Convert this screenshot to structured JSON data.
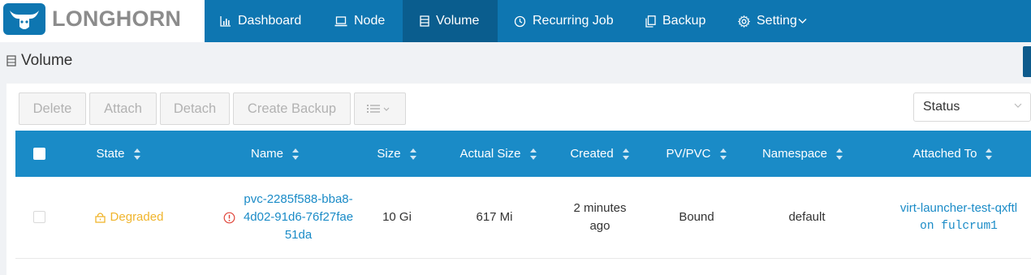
{
  "app": {
    "name": "LONGHORN"
  },
  "nav": [
    {
      "label": "Dashboard",
      "icon": "bar-chart-icon"
    },
    {
      "label": "Node",
      "icon": "laptop-icon"
    },
    {
      "label": "Volume",
      "icon": "database-icon",
      "active": true
    },
    {
      "label": "Recurring Job",
      "icon": "clock-icon"
    },
    {
      "label": "Backup",
      "icon": "copy-icon"
    },
    {
      "label": "Setting",
      "icon": "gear-icon"
    }
  ],
  "page": {
    "title": "Volume"
  },
  "toolbar": {
    "delete": "Delete",
    "attach": "Attach",
    "detach": "Detach",
    "create_backup": "Create Backup"
  },
  "filter": {
    "placeholder": "Status"
  },
  "columns": [
    "State",
    "Name",
    "Size",
    "Actual Size",
    "Created",
    "PV/PVC",
    "Namespace",
    "Attached To"
  ],
  "rows": [
    {
      "state": "Degraded",
      "name_lines": [
        "pvc-2285f588-bba8-",
        "4d02-91d6-76f27fae",
        "51da"
      ],
      "size": "10 Gi",
      "actual_size": "617 Mi",
      "created_lines": [
        "2 minutes",
        "ago"
      ],
      "pv_pvc": "Bound",
      "namespace": "default",
      "attached_to": "virt-launcher-test-qxftl",
      "attached_node": "on fulcrum1"
    }
  ],
  "colors": {
    "brand": "#0e76b1",
    "active_nav": "#0a5d8e",
    "table_header": "#1a8bc7",
    "degraded": "#f0b52d",
    "link": "#1a8bc7",
    "warning": "#e0453a"
  }
}
